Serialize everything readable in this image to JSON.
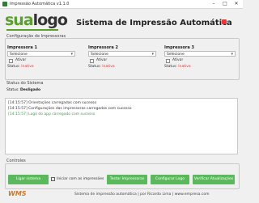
{
  "window": {
    "title": "Impressão Automática v1.1.0",
    "controls": [
      "–",
      "□",
      "✕"
    ]
  },
  "header": {
    "logo_part1": "sua",
    "logo_part2": "logo",
    "title": "Sistema de Impressão Automática"
  },
  "config": {
    "title": "Configuração de Impressoras",
    "printers": [
      {
        "label": "Impressora 1",
        "selected": "Selecione",
        "checkbox_label": "Ativar",
        "status_label": "Status:",
        "status_value": "Inativa"
      },
      {
        "label": "Impressora 2",
        "selected": "Selecione",
        "checkbox_label": "Ativar",
        "status_label": "Status:",
        "status_value": "Inativa"
      },
      {
        "label": "Impressora 3",
        "selected": "Selecione",
        "checkbox_label": "Ativar",
        "status_label": "Status:",
        "status_value": "Inativa"
      }
    ]
  },
  "system": {
    "title": "Status do Sistema",
    "status_label": "Status:",
    "status_value": "Desligado",
    "log": [
      "[14:15:57] Orientações carregadas com sucesso",
      "[14:15:57] Configurações das impressoras carregadas com sucesso",
      "[14:15:57] Logo do app carregado com sucesso"
    ]
  },
  "controls": {
    "title": "Controles",
    "start_label": "Ligar sistema",
    "auto_print_label": "Iniciar com as impressões",
    "test_label": "Testar Impressoras",
    "configure_label": "Configurar Logo",
    "updates_label": "Verificar Atualizações"
  },
  "footer": {
    "brand": "WMS",
    "text": "Sistema de impressão automática | por Ricardo Lima | www.empresa.com"
  },
  "colors": {
    "accent": "#5cb85c",
    "logo_green": "#5aa02c",
    "status_off": "#e53935"
  }
}
